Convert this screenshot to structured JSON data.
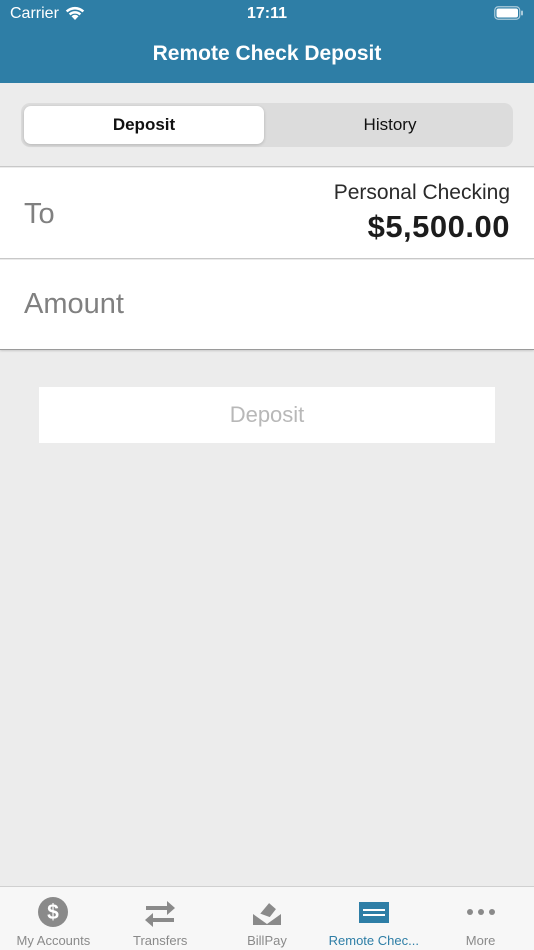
{
  "status": {
    "carrier": "Carrier",
    "time": "17:11"
  },
  "nav": {
    "title": "Remote Check Deposit"
  },
  "segments": [
    {
      "label": "Deposit",
      "selected": true
    },
    {
      "label": "History",
      "selected": false
    }
  ],
  "to": {
    "label": "To",
    "account_name": "Personal Checking",
    "balance": "$5,500.00"
  },
  "amount": {
    "label": "Amount"
  },
  "deposit_button": {
    "label": "Deposit",
    "enabled": false
  },
  "tabs": [
    {
      "label": "My Accounts",
      "icon": "dollar-icon"
    },
    {
      "label": "Transfers",
      "icon": "transfer-icon"
    },
    {
      "label": "BillPay",
      "icon": "billpay-icon"
    },
    {
      "label": "Remote Chec...",
      "icon": "check-card-icon",
      "active": true
    },
    {
      "label": "More",
      "icon": "more-icon"
    }
  ],
  "colors": {
    "brand": "#2e7ea6",
    "background": "#ececec",
    "tab_inactive": "#8a8a8a"
  }
}
